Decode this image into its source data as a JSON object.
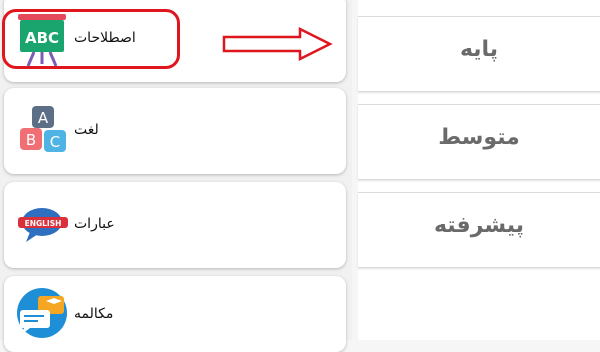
{
  "menu": {
    "items": [
      {
        "label": "اصطلاحات",
        "icon": "abc-easel-icon"
      },
      {
        "label": "لغت",
        "icon": "abc-blocks-icon"
      },
      {
        "label": "عبارات",
        "icon": "english-speech-bubble-icon"
      },
      {
        "label": "مکالمه",
        "icon": "chat-conversation-icon"
      }
    ]
  },
  "levels": {
    "items": [
      {
        "label": "پایه"
      },
      {
        "label": "متوسط"
      },
      {
        "label": "پیشرفته"
      }
    ]
  },
  "icon_text": {
    "easel": "ABC",
    "block_a": "A",
    "block_b": "B",
    "block_c": "C",
    "english": "ENGLISH"
  },
  "colors": {
    "highlight": "#e0161e",
    "level_text": "#6a6a6a"
  }
}
